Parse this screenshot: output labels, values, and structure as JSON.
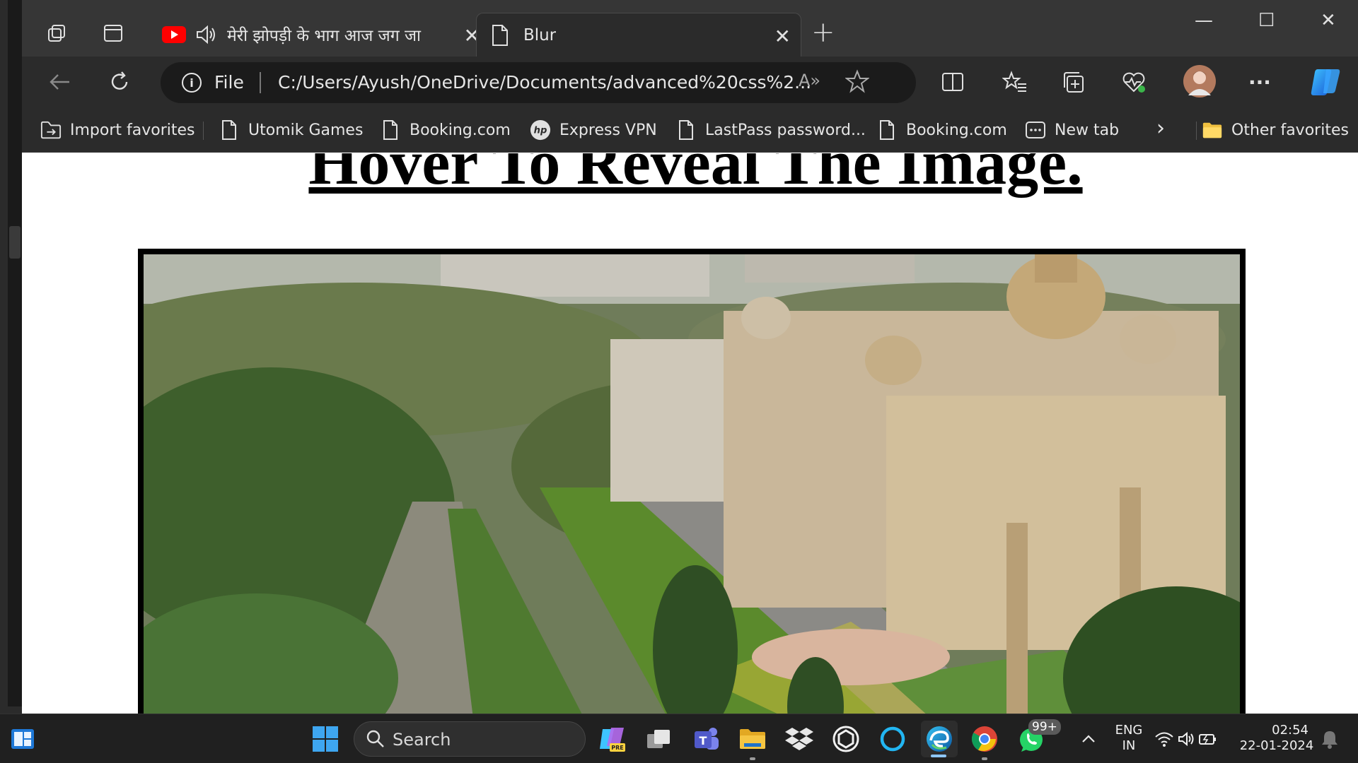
{
  "browser": {
    "tabs": [
      {
        "title": "मेरी झोपड़ी के भाग आज जग जा",
        "close": "✕"
      },
      {
        "title": "Blur",
        "close": "✕"
      }
    ],
    "new_tab": "+",
    "window": {
      "minimize": "—",
      "maximize": "☐",
      "close": "✕"
    }
  },
  "toolbar": {
    "protocol_label": "File",
    "url": "C:/Users/Ayush/OneDrive/Documents/advanced%20css%2...",
    "read_aloud": "A»",
    "more": "···"
  },
  "favorites": {
    "items": [
      {
        "label": "Import favorites",
        "icon": "import-icon"
      },
      {
        "label": "Utomik Games",
        "icon": "page-icon"
      },
      {
        "label": "Booking.com",
        "icon": "page-icon"
      },
      {
        "label": "Express VPN",
        "icon": "hp-icon"
      },
      {
        "label": "LastPass password...",
        "icon": "page-icon"
      },
      {
        "label": "Booking.com",
        "icon": "page-icon"
      },
      {
        "label": "New tab",
        "icon": "newtab-icon"
      }
    ],
    "overflow": "›",
    "other": "Other favorites"
  },
  "page": {
    "heading": "Hover To Reveal The Image."
  },
  "taskbar": {
    "search_label": "Search",
    "whatsapp_badge": "99+",
    "language": "ENG",
    "region": "IN",
    "time": "02:54",
    "date": "22-01-2024"
  }
}
